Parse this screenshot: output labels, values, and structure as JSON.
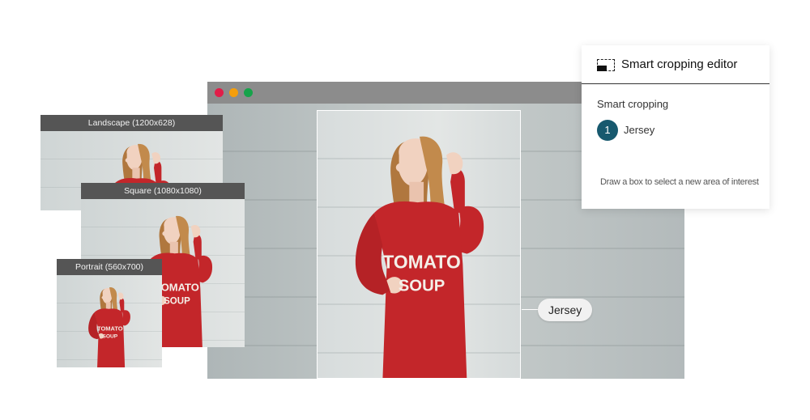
{
  "browser": {
    "controls": [
      "close-dot",
      "minimize-dot",
      "maximize-dot"
    ],
    "tag_label": "Jersey"
  },
  "previews": [
    {
      "label": "Landscape (1200x628)"
    },
    {
      "label": "Square (1080x1080)"
    },
    {
      "label": "Portrait (560x700)"
    }
  ],
  "shirt_text": {
    "line1": "TOMATO",
    "line2": "SOUP"
  },
  "panel": {
    "title": "Smart cropping editor",
    "section_title": "Smart cropping",
    "items": [
      {
        "number": "1",
        "label": "Jersey"
      }
    ],
    "hint": "Draw a box to select a new area of interest"
  },
  "colors": {
    "accent": "#17596e",
    "sweater": "#c3262a",
    "window_bar": "#8c8c8c",
    "dot_red": "#e11d48",
    "dot_orange": "#f59e0b",
    "dot_green": "#16a34a"
  }
}
